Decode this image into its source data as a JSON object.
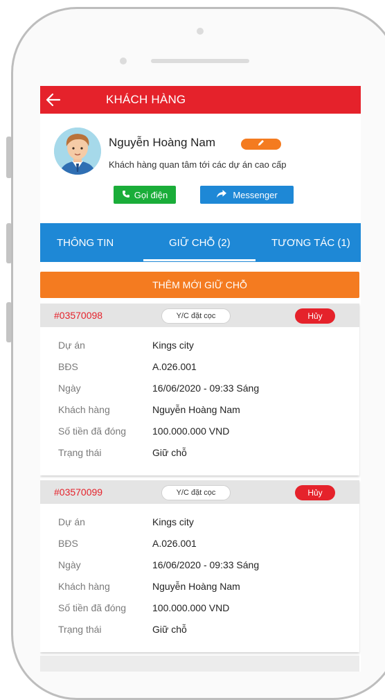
{
  "appbar": {
    "title": "KHÁCH HÀNG"
  },
  "customer": {
    "name": "Nguyễn Hoàng Nam",
    "description": "Khách hàng quan tâm tới các dự án cao cấp",
    "call_label": "Gọi điện",
    "messenger_label": "Messenger"
  },
  "tabs": [
    {
      "label": "THÔNG TIN"
    },
    {
      "label": "GIỮ CHỖ (2)",
      "active": true
    },
    {
      "label": "TƯƠNG TÁC (1)"
    }
  ],
  "add_button_label": "THÊM MỚI GIỮ CHỖ",
  "bookings": [
    {
      "code": "#03570098",
      "request_label": "Y/C đặt cọc",
      "cancel_label": "Hủy",
      "fields": [
        {
          "label": "Dự án",
          "value": "Kings city"
        },
        {
          "label": "BĐS",
          "value": "A.026.001"
        },
        {
          "label": "Ngày",
          "value": "16/06/2020 - 09:33 Sáng"
        },
        {
          "label": "Khách hàng",
          "value": "Nguyễn Hoàng Nam"
        },
        {
          "label": "Số tiền đã đóng",
          "value": "100.000.000 VND"
        },
        {
          "label": "Trạng thái",
          "value": "Giữ chỗ"
        }
      ]
    },
    {
      "code": "#03570099",
      "request_label": "Y/C đặt cọc",
      "cancel_label": "Hủy",
      "fields": [
        {
          "label": "Dự án",
          "value": "Kings city"
        },
        {
          "label": "BĐS",
          "value": "A.026.001"
        },
        {
          "label": "Ngày",
          "value": "16/06/2020 - 09:33 Sáng"
        },
        {
          "label": "Khách hàng",
          "value": "Nguyễn Hoàng Nam"
        },
        {
          "label": "Số tiền đã đóng",
          "value": "100.000.000 VND"
        },
        {
          "label": "Trạng thái",
          "value": "Giữ chỗ"
        }
      ]
    }
  ],
  "colors": {
    "appbar": "#e5222b",
    "tabs": "#1e88d6",
    "accent_orange": "#f47b20",
    "call_green": "#1aad39",
    "code_red": "#e5222b"
  },
  "icons": {
    "back": "arrow-left-icon",
    "edit": "pencil-icon",
    "call": "phone-icon",
    "messenger": "share-arrow-icon"
  }
}
